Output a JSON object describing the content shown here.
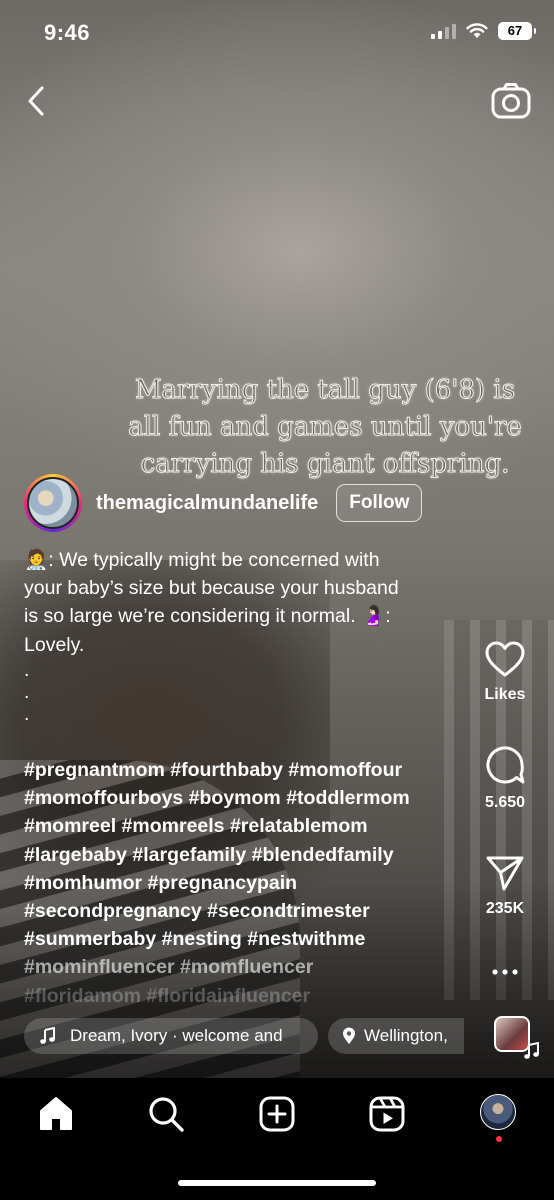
{
  "status_bar": {
    "time": "9:46",
    "battery": "67"
  },
  "video": {
    "overlay_lines": [
      "Marrying the tall guy (6'8) is",
      "all fun and games until you're",
      "carrying his giant offspring."
    ]
  },
  "post": {
    "username": "themagicalmundanelife",
    "follow_label": "Follow",
    "caption_lines": [
      "🧑‍⚕️: We typically might be concerned with",
      "your baby’s size but because your husband",
      "is so large we’re considering it normal. 🤰🏻:",
      "Lovely."
    ],
    "dots": [
      ".",
      ".",
      "."
    ],
    "hashtag_lines": [
      "#pregnantmom #fourthbaby #momoffour",
      "#momoffourboys #boymom #toddlermom",
      "#momreel #momreels #relatablemom",
      "#largebaby #largefamily #blendedfamily",
      "#momhumor #pregnancypain",
      "#secondpregnancy #secondtrimester",
      "#summerbaby #nesting #nestwithme",
      "#mominfluencer #momfluencer",
      "#floridamom #floridainfluencer"
    ]
  },
  "actions": {
    "likes_label": "Likes",
    "comments_count": "5.650",
    "shares_count": "235K"
  },
  "audio": {
    "label": "Dream, Ivory · welcome and"
  },
  "location": {
    "label": "Wellington,"
  },
  "nav": {
    "icons": [
      "home-icon",
      "search-icon",
      "create-icon",
      "reels-icon",
      "profile-avatar"
    ]
  }
}
